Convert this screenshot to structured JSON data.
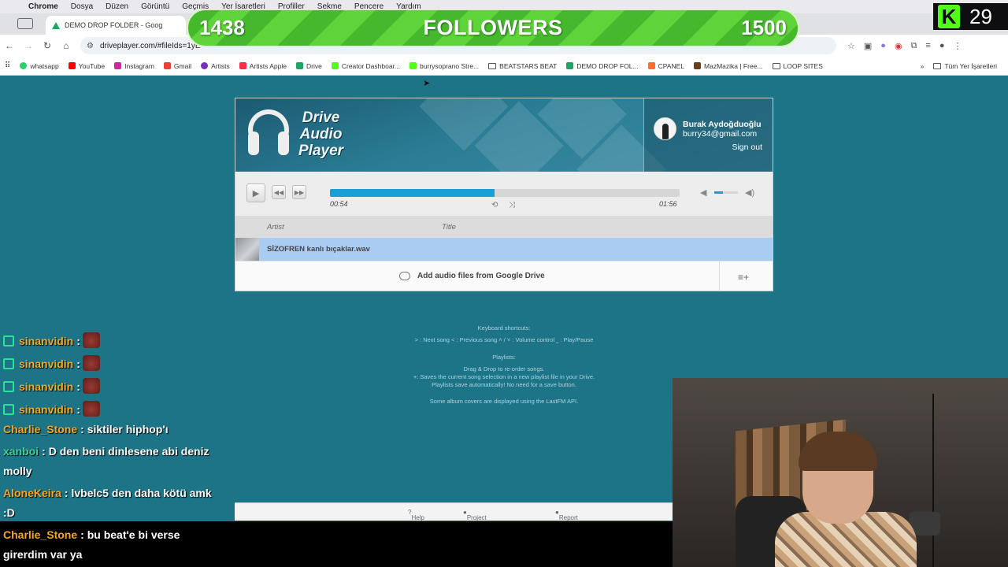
{
  "menubar": {
    "apple": "",
    "items": [
      "Chrome",
      "Dosya",
      "Düzen",
      "Görüntü",
      "Geçmiş",
      "Yer İşaretleri",
      "Profiller",
      "Sekme",
      "Pencere",
      "Yardım"
    ]
  },
  "browser": {
    "tab_title": "DEMO DROP FOLDER - Goog",
    "url": "driveplayer.com/#fileIds=1yE"
  },
  "bookmarks": [
    {
      "label": "whatsapp",
      "color": "#25d366"
    },
    {
      "label": "YouTube",
      "color": "#ff0000"
    },
    {
      "label": "Instagram",
      "color": "#d6249f"
    },
    {
      "label": "Gmail",
      "color": "#ea4335"
    },
    {
      "label": "Artists",
      "color": "#7b2fbf"
    },
    {
      "label": "Artists Apple",
      "color": "#fa2d48"
    },
    {
      "label": "Drive",
      "color": "#1fa463"
    },
    {
      "label": "Creator Dashboar...",
      "color": "#53fc18"
    },
    {
      "label": "burrysoprano Stre...",
      "color": "#53fc18"
    },
    {
      "label": "BEATSTARS BEAT",
      "color": "folder"
    },
    {
      "label": "DEMO DROP FOL...",
      "color": "#1fa463"
    },
    {
      "label": "CPANEL",
      "color": "#ff6c2c"
    },
    {
      "label": "MazMazika | Free...",
      "color": "#6b3e1e"
    },
    {
      "label": "LOOP SITES",
      "color": "folder"
    }
  ],
  "bookmarks_right": {
    "more": "»",
    "all": "Tüm Yer İşaretleri"
  },
  "overlay": {
    "followers_current": "1438",
    "followers_label": "FOLLOWERS",
    "followers_goal": "1500",
    "kick_letter": "K",
    "kick_count": "29"
  },
  "player": {
    "logo_line1": "Drive",
    "logo_line2": "Audio",
    "logo_line3": "Player",
    "user_name": "Burak Aydoğduoğlu",
    "user_email": "burry34@gmail.com",
    "sign_out": "Sign out",
    "elapsed": "00:54",
    "duration": "01:56",
    "progress": 0.47,
    "volume": 0.35,
    "col_artist": "Artist",
    "col_title": "Title",
    "tracks": [
      {
        "title": "SİZOFREN kanlı bıçaklar.wav"
      }
    ],
    "add_label": "Add audio files from Google Drive"
  },
  "info": {
    "shortcuts_title": "Keyboard shortcuts:",
    "shortcuts_line": "˃ : Next song  ˂ : Previous song  ˄ / ˅ : Volume control  ˽ : Play/Pause",
    "playlists_title": "Playlists:",
    "playlists_l1": "Drag & Drop to re-order songs.",
    "playlists_l2": "+: Saves the current song selection in a new playlist file in your Drive.",
    "playlists_l3": "Playlists save automatically! No need for a save button.",
    "lastfm": "Some album covers are displayed using the LastFM API."
  },
  "footer": {
    "help": "Help",
    "github": "Project on GitHub",
    "bug": "Report a bug"
  },
  "chat": [
    {
      "user": "sinanvidin",
      "color": "#f5a623",
      "text": "",
      "badge": true,
      "emote": true
    },
    {
      "user": "sinanvidin",
      "color": "#f5a623",
      "text": "",
      "badge": true,
      "emote": true
    },
    {
      "user": "sinanvidin",
      "color": "#f5a623",
      "text": "",
      "badge": true,
      "emote": true
    },
    {
      "user": "sinanvidin",
      "color": "#f5a623",
      "text": "",
      "badge": true,
      "emote": true
    },
    {
      "user": "Charlie_Stone",
      "color": "#f5a623",
      "text": "siktiler hiphop'ı"
    },
    {
      "user": "xanboi",
      "color": "#3fd19a",
      "text": "D den beni dinlesene abi deniz"
    },
    {
      "user": "",
      "color": "#fff",
      "text": "molly"
    },
    {
      "user": "AloneKeira",
      "color": "#f5a623",
      "text": "lvbelc5 den daha kötü amk"
    },
    {
      "user": "",
      "color": "#fff",
      "text": ":D"
    },
    {
      "user": "Charlie_Stone",
      "color": "#f5a623",
      "text": "bu beat'e bi verse"
    },
    {
      "user": "",
      "color": "#fff",
      "text": "girerdim var ya"
    }
  ]
}
